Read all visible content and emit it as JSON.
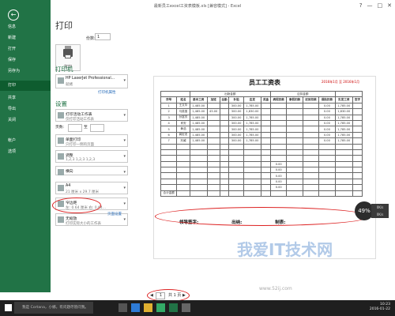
{
  "titlebar": {
    "title": "最新员工excel工资表模板.xls [兼容模式] - Excel",
    "controls": [
      "?",
      "—",
      "□",
      "✕"
    ]
  },
  "backstage": {
    "items": [
      {
        "label": "信息",
        "active": false
      },
      {
        "label": "新建",
        "active": false
      },
      {
        "label": "打开",
        "active": false
      },
      {
        "label": "保存",
        "active": false
      },
      {
        "label": "另存为",
        "active": false
      },
      {
        "label": "打印",
        "active": true
      },
      {
        "label": "共享",
        "active": false
      },
      {
        "label": "导出",
        "active": false
      },
      {
        "label": "关闭",
        "active": false
      },
      {
        "label": "帐户",
        "active": false
      },
      {
        "label": "选项",
        "active": false
      }
    ]
  },
  "print": {
    "title": "打印",
    "button_label": "打印",
    "copies_label": "份数:",
    "copies_value": "1",
    "printer_section": "打印机",
    "printer_name": "HP LaserJet Professional...",
    "printer_status": "就绪",
    "printer_props": "打印机属性",
    "settings_section": "设置",
    "settings": [
      {
        "l1": "打印活动工作表",
        "l2": "仅打印活动工作表"
      },
      {
        "l1": "单面打印",
        "l2": "只打印一侧的页面"
      },
      {
        "l1": "调整",
        "l2": "1,2,3   1,2,3   1,2,3"
      },
      {
        "l1": "横向",
        "l2": ""
      },
      {
        "l1": "A4",
        "l2": "21 厘米 x 29.7 厘米"
      },
      {
        "l1": "窄边距",
        "l2": "左: 0.64 厘米  右: 0.64..."
      },
      {
        "l1": "无缩放",
        "l2": "打印实际大小的工作表"
      }
    ],
    "pages_label": "页数:",
    "pages_to": "至",
    "page_setup": "页面设置"
  },
  "sheet": {
    "title": "员工工资表",
    "subtitle": "2016年1月 至 2016年1月",
    "header_groups": {
      "attendance": "出勤金额",
      "deduction": "应扣金额"
    },
    "columns": [
      "序号",
      "姓名",
      "基本工资",
      "加班",
      "全勤",
      "补贴",
      "应发",
      "奖金",
      "病假扣款",
      "事假扣款",
      "迟到扣款",
      "保险扣款",
      "实发工资",
      "签字"
    ],
    "rows": [
      [
        "1",
        "王文华",
        "1,485.00",
        "",
        "",
        "300.00",
        "1,785.00",
        "",
        "",
        "",
        "",
        "0.00",
        "1,785.00",
        ""
      ],
      [
        "2",
        "马英惠",
        "1,485.00",
        "45.00",
        "",
        "300.00",
        "1,830.00",
        "",
        "",
        "",
        "",
        "0.00",
        "1,830.00",
        ""
      ],
      [
        "3",
        "孙富芳",
        "1,485.00",
        "",
        "",
        "300.00",
        "1,785.00",
        "",
        "",
        "",
        "",
        "0.00",
        "1,785.00",
        ""
      ],
      [
        "4",
        "肖安",
        "1,485.00",
        "",
        "",
        "300.00",
        "1,785.00",
        "",
        "",
        "",
        "",
        "0.00",
        "1,785.00",
        ""
      ],
      [
        "5",
        "黄浩",
        "1,485.00",
        "",
        "",
        "300.00",
        "1,785.00",
        "",
        "",
        "",
        "",
        "0.00",
        "1,785.00",
        ""
      ],
      [
        "6",
        "龚宏发",
        "1,485.00",
        "",
        "",
        "300.00",
        "1,785.00",
        "",
        "",
        "",
        "",
        "0.00",
        "1,785.00",
        ""
      ],
      [
        "7",
        "刘威",
        "1,485.00",
        "",
        "",
        "300.00",
        "1,785.00",
        "",
        "",
        "",
        "",
        "0.00",
        "1,785.00",
        ""
      ],
      [
        "",
        "",
        "",
        "",
        "",
        "",
        "",
        "",
        "",
        "",
        "",
        "",
        "",
        ""
      ],
      [
        "",
        "",
        "",
        "",
        "",
        "",
        "",
        "",
        "",
        "",
        "",
        "",
        "",
        ""
      ],
      [
        "",
        "",
        "",
        "",
        "",
        "",
        "",
        "",
        "",
        "",
        "",
        "",
        "",
        ""
      ],
      [
        "",
        "",
        "",
        "",
        "",
        "",
        "",
        "",
        "0.00",
        "",
        "",
        "",
        "",
        ""
      ],
      [
        "",
        "",
        "",
        "",
        "",
        "",
        "",
        "",
        "0.00",
        "",
        "",
        "",
        "",
        ""
      ],
      [
        "",
        "",
        "",
        "",
        "",
        "",
        "",
        "",
        "0.00",
        "",
        "",
        "",
        "",
        ""
      ],
      [
        "",
        "",
        "",
        "",
        "",
        "",
        "",
        "",
        "0.00",
        "",
        "",
        "",
        "",
        ""
      ],
      [
        "",
        "",
        "",
        "",
        "",
        "",
        "",
        "",
        "0.00",
        "",
        "",
        "",
        "",
        ""
      ],
      [
        "合计金额",
        "",
        "",
        "",
        "",
        "",
        "",
        "",
        "",
        "",
        "",
        "",
        "",
        ""
      ]
    ],
    "sign_labels": [
      "领导签字:",
      "出纳:",
      "制表:"
    ]
  },
  "zoom": {
    "percent": "49%",
    "side1": "0K/s",
    "side2": "0K/s"
  },
  "pager": {
    "current": "1",
    "of_total": "共 1 页"
  },
  "taskbar": {
    "search_placeholder": "我是 Cortana，小娜。有问题尽管问我。",
    "time": "10:23",
    "date": "2016-01-22"
  },
  "watermark": {
    "text": "我爱IT技术网",
    "url": "www.52ij.com"
  },
  "colors": {
    "accent": "#217346",
    "annotation": "#d22222"
  }
}
